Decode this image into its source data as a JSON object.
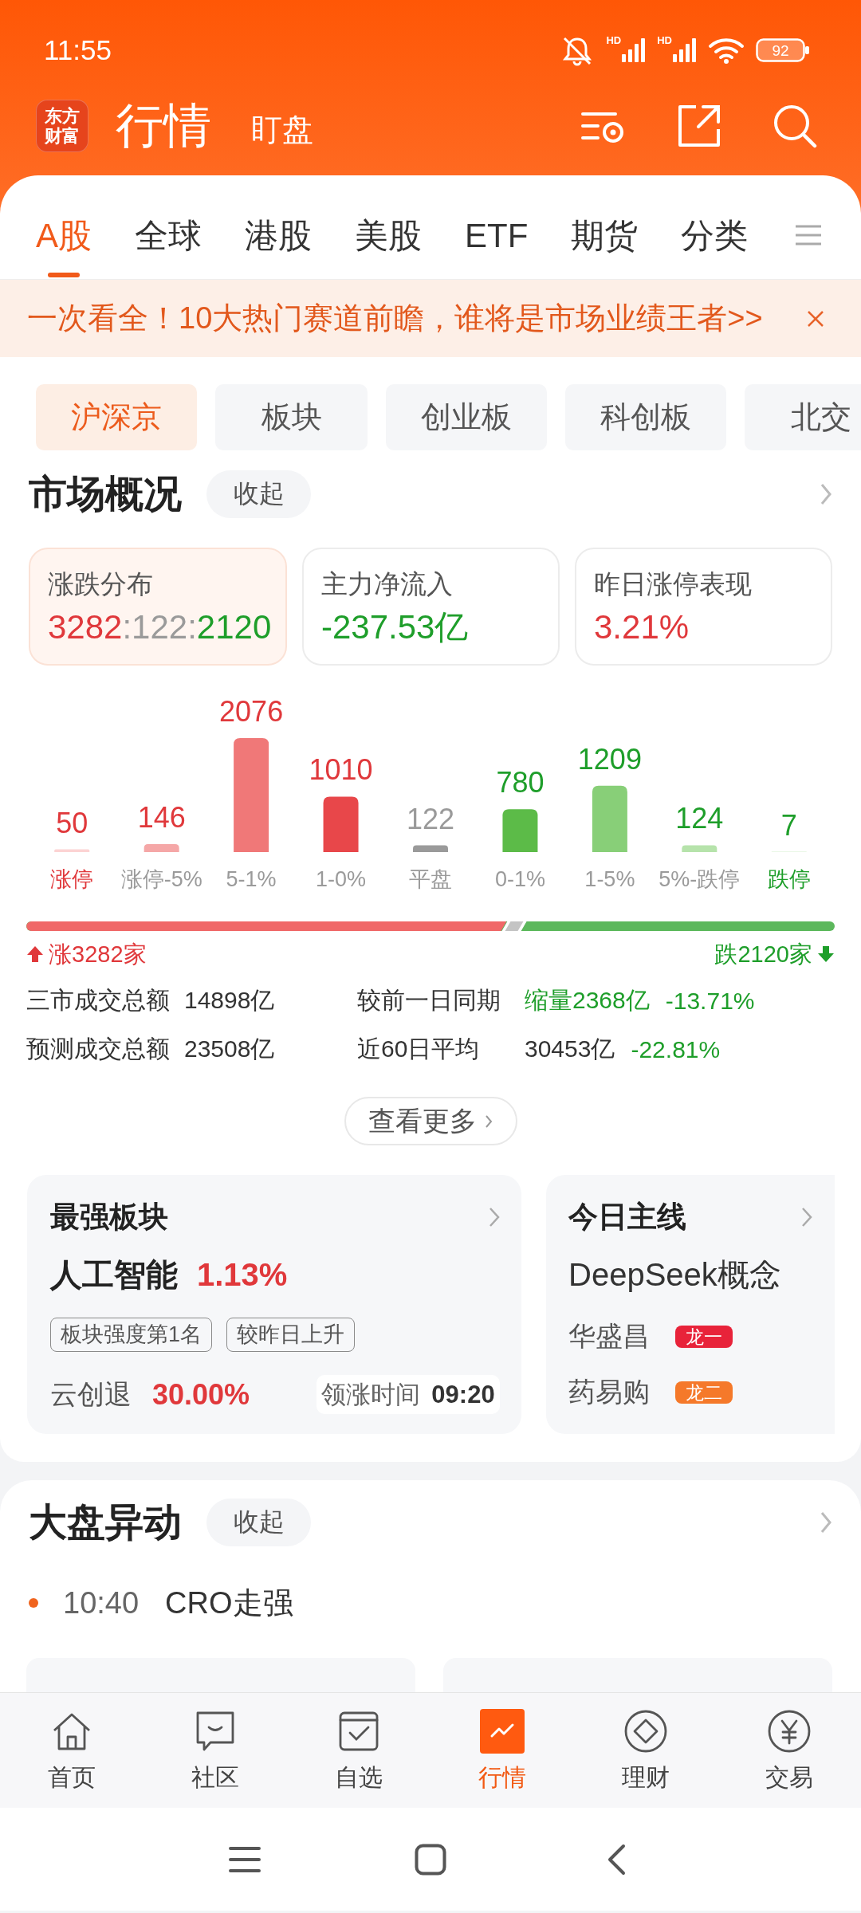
{
  "status_bar": {
    "time": "11:55",
    "network_labels": [
      "HD",
      "HD"
    ],
    "battery": "92"
  },
  "header": {
    "logo_lines": [
      "东方",
      "财富"
    ],
    "title": "行情",
    "subtitle": "盯盘"
  },
  "tabs": [
    {
      "label": "A股",
      "selected": true
    },
    {
      "label": "全球",
      "selected": false
    },
    {
      "label": "港股",
      "selected": false
    },
    {
      "label": "美股",
      "selected": false
    },
    {
      "label": "ETF",
      "selected": false
    },
    {
      "label": "期货",
      "selected": false
    },
    {
      "label": "分类",
      "selected": false
    }
  ],
  "banner": {
    "text": "一次看全！10大热门赛道前瞻，谁将是市场业绩王者>>"
  },
  "market_chips": [
    {
      "label": "沪深京",
      "selected": true
    },
    {
      "label": "板块",
      "selected": false
    },
    {
      "label": "创业板",
      "selected": false
    },
    {
      "label": "科创板",
      "selected": false
    },
    {
      "label": "北交",
      "selected": false
    }
  ],
  "market_overview": {
    "title": "市场概况",
    "collapse_label": "收起",
    "cards": [
      {
        "label": "涨跌分布",
        "selected": true,
        "value_parts": [
          {
            "text": "3282",
            "color": "#e0383b"
          },
          {
            "text": ":122:",
            "color": "#9a9a9a"
          },
          {
            "text": "2120",
            "color": "#1e9e2a"
          }
        ]
      },
      {
        "label": "主力净流入",
        "selected": false,
        "value_parts": [
          {
            "text": "-237.53亿",
            "color": "#1e9e2a"
          }
        ]
      },
      {
        "label": "昨日涨停表现",
        "selected": false,
        "value_parts": [
          {
            "text": "3.21%",
            "color": "#e0383b"
          }
        ]
      }
    ],
    "chart_data": {
      "type": "bar",
      "categories": [
        "涨停",
        "涨停-5%",
        "5-1%",
        "1-0%",
        "平盘",
        "0-1%",
        "1-5%",
        "5%-跌停",
        "跌停"
      ],
      "values": [
        50,
        146,
        2076,
        1010,
        122,
        780,
        1209,
        124,
        7
      ],
      "data_labels": true
    },
    "breadth_bar": {
      "level": 0.594,
      "up_label": "涨3282家",
      "down_label": "跌2120家"
    },
    "turnover": [
      {
        "label": "三市成交总额",
        "value": "14898亿",
        "compare_label": "较前一日同期",
        "compare_value": {
          "text": "缩量2368亿",
          "color": "#1e9e2a"
        },
        "change": {
          "text": "-13.71%",
          "color": "#1e9e2a"
        }
      },
      {
        "label": "预测成交总额",
        "value": "23508亿",
        "compare_label": "近60日平均",
        "compare_value": {
          "text": "30453亿",
          "color": "#333333"
        },
        "change": {
          "text": "-22.81%",
          "color": "#1e9e2a"
        }
      }
    ],
    "more_button": "查看更多"
  },
  "strongest_sector": {
    "title": "最强板块",
    "name": "人工智能",
    "change": "1.13%",
    "tags": [
      "板块强度第1名",
      "较昨日上升"
    ],
    "leader": "云创退",
    "leader_change": "30.00%",
    "lead_time_label": "领涨时间",
    "lead_time": "09:20"
  },
  "main_theme": {
    "title": "今日主线",
    "name": "DeepSeek概念",
    "stocks": [
      {
        "name": "华盛昌",
        "badge": "龙一",
        "color": "#e8233a"
      },
      {
        "name": "药易购",
        "badge": "龙二",
        "color": "#f5792a"
      }
    ]
  },
  "market_moves": {
    "title": "大盘异动",
    "collapse_label": "收起",
    "events": [
      {
        "time": "10:40",
        "text": "CRO走强"
      }
    ]
  },
  "bottom_nav": [
    {
      "label": "首页",
      "selected": false
    },
    {
      "label": "社区",
      "selected": false
    },
    {
      "label": "自选",
      "selected": false
    },
    {
      "label": "行情",
      "selected": true
    },
    {
      "label": "理财",
      "selected": false
    },
    {
      "label": "交易",
      "selected": false
    }
  ]
}
